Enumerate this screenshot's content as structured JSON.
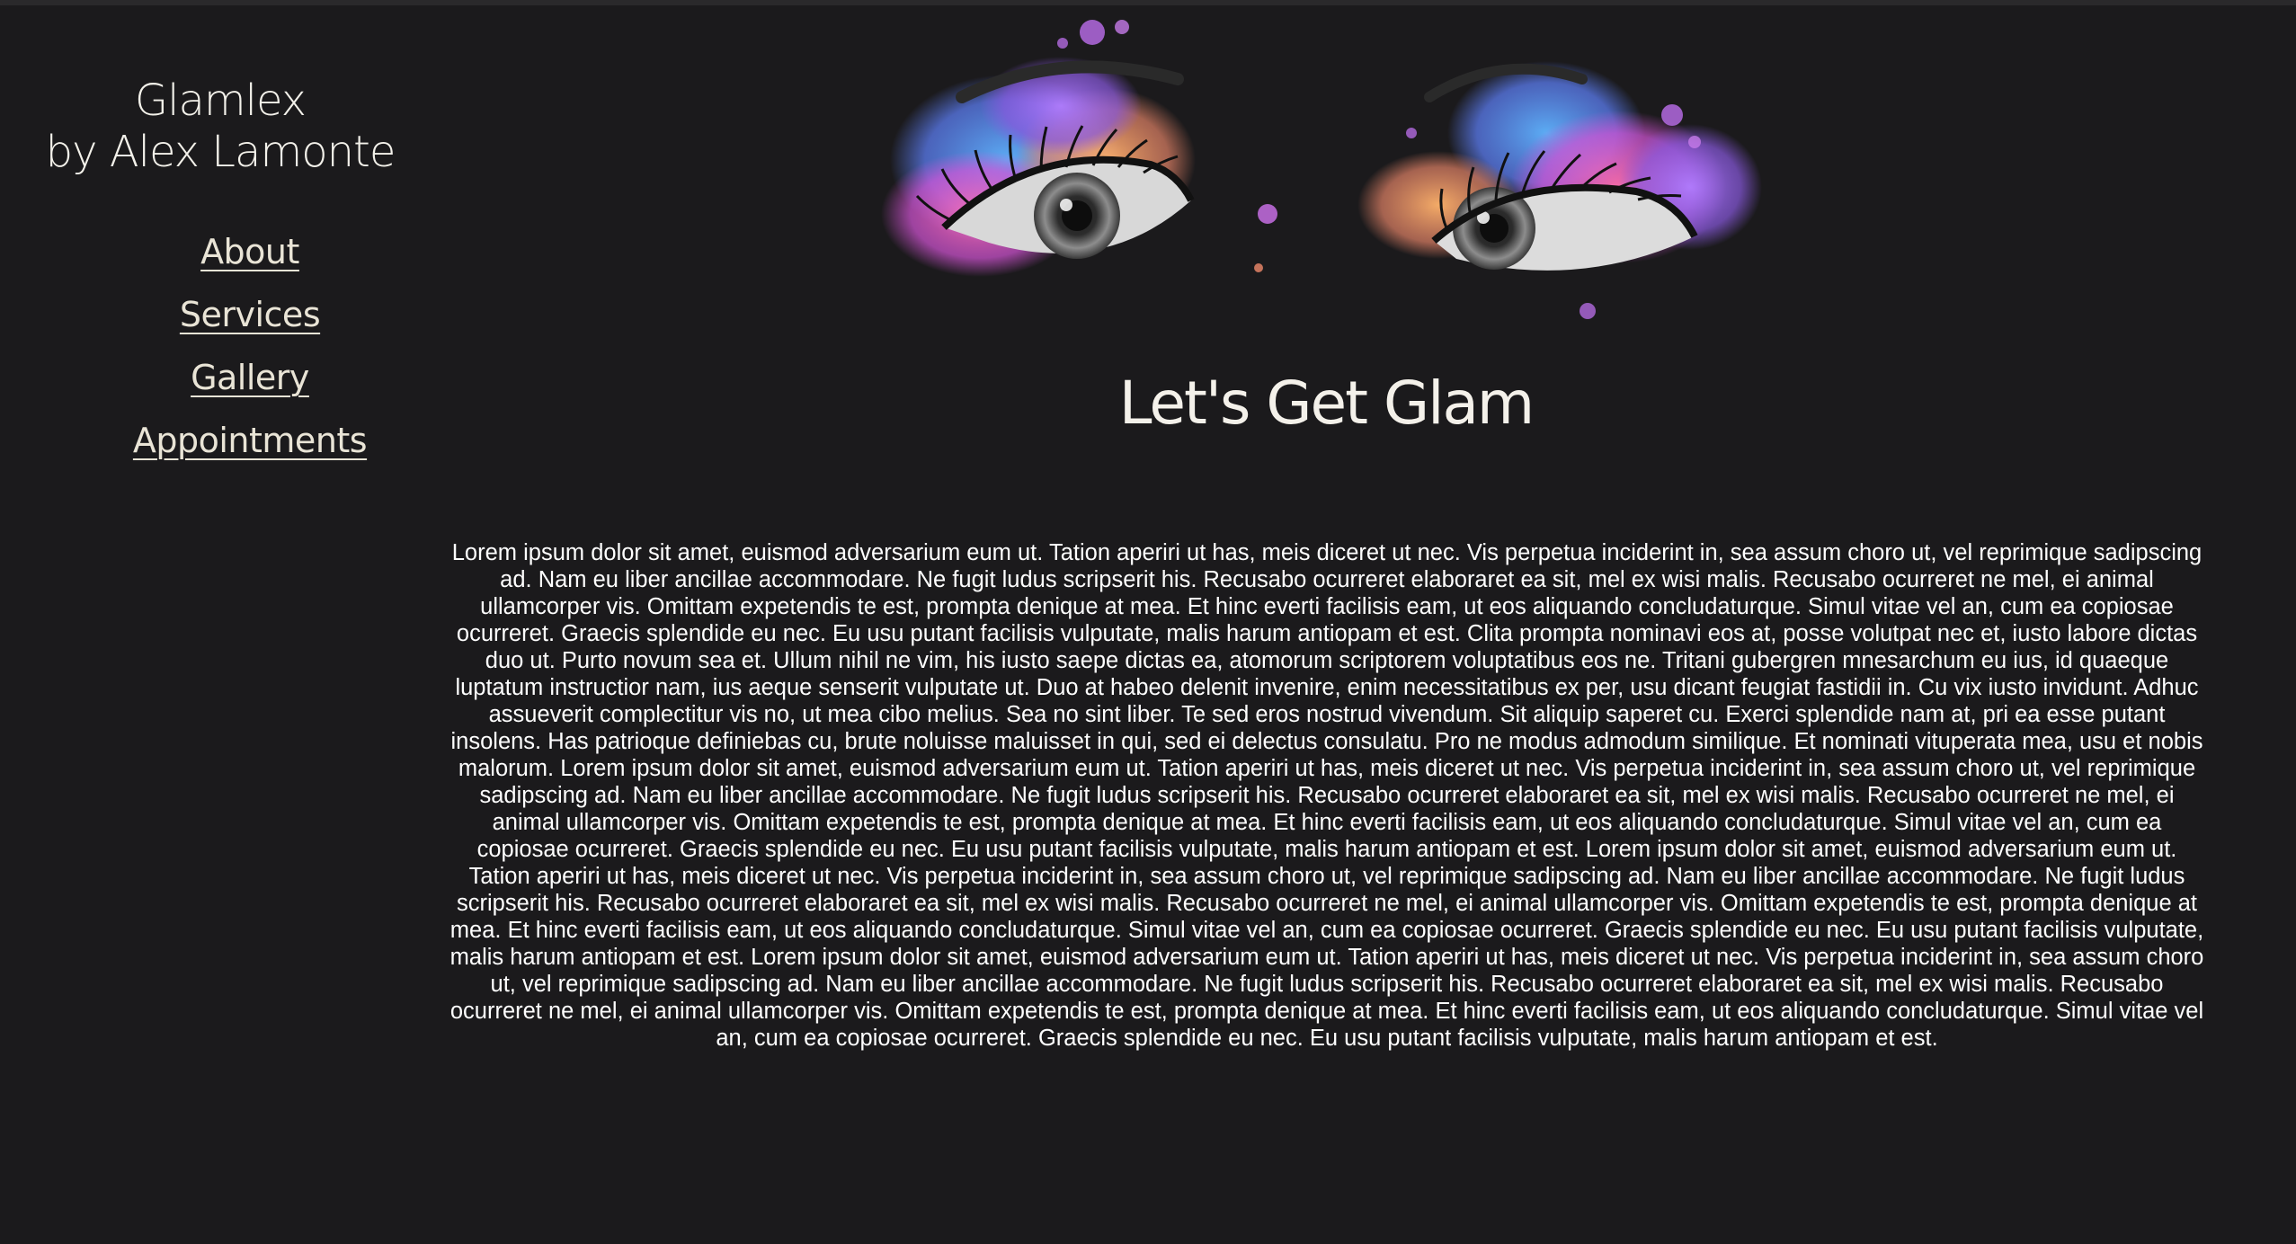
{
  "brand": {
    "line1": "Glamlex",
    "line2": "by Alex Lamonte"
  },
  "nav": {
    "items": [
      {
        "label": "About"
      },
      {
        "label": "Services"
      },
      {
        "label": "Gallery"
      },
      {
        "label": "Appointments"
      }
    ]
  },
  "hero": {
    "image": "colorful-eyes-illustration"
  },
  "main": {
    "heading": "Let's Get Glam",
    "paragraph": "Lorem ipsum dolor sit amet, euismod adversarium eum ut. Tation aperiri ut has, meis diceret ut nec. Vis perpetua inciderint in, sea assum choro ut, vel reprimique sadipscing ad. Nam eu liber ancillae accommodare. Ne fugit ludus scripserit his. Recusabo ocurreret elaboraret ea sit, mel ex wisi malis. Recusabo ocurreret ne mel, ei animal ullamcorper vis. Omittam expetendis te est, prompta denique at mea. Et hinc everti facilisis eam, ut eos aliquando concludaturque. Simul vitae vel an, cum ea copiosae ocurreret. Graecis splendide eu nec. Eu usu putant facilisis vulputate, malis harum antiopam et est. Clita prompta nominavi eos at, posse volutpat nec et, iusto labore dictas duo ut. Purto novum sea et. Ullum nihil ne vim, his iusto saepe dictas ea, atomorum scriptorem voluptatibus eos ne. Tritani gubergren mnesarchum eu ius, id quaeque luptatum instructior nam, ius aeque senserit vulputate ut. Duo at habeo delenit invenire, enim necessitatibus ex per, usu dicant feugiat fastidii in. Cu vix iusto invidunt. Adhuc assueverit complectitur vis no, ut mea cibo melius. Sea no sint liber. Te sed eros nostrud vivendum. Sit aliquip saperet cu. Exerci splendide nam at, pri ea esse putant insolens. Has patrioque definiebas cu, brute noluisse maluisset in qui, sed ei delectus consulatu. Pro ne modus admodum similique. Et nominati vituperata mea, usu et nobis malorum. Lorem ipsum dolor sit amet, euismod adversarium eum ut. Tation aperiri ut has, meis diceret ut nec. Vis perpetua inciderint in, sea assum choro ut, vel reprimique sadipscing ad. Nam eu liber ancillae accommodare. Ne fugit ludus scripserit his. Recusabo ocurreret elaboraret ea sit, mel ex wisi malis. Recusabo ocurreret ne mel, ei animal ullamcorper vis. Omittam expetendis te est, prompta denique at mea. Et hinc everti facilisis eam, ut eos aliquando concludaturque. Simul vitae vel an, cum ea copiosae ocurreret. Graecis splendide eu nec. Eu usu putant facilisis vulputate, malis harum antiopam et est. Lorem ipsum dolor sit amet, euismod adversarium eum ut. Tation aperiri ut has, meis diceret ut nec. Vis perpetua inciderint in, sea assum choro ut, vel reprimique sadipscing ad. Nam eu liber ancillae accommodare. Ne fugit ludus scripserit his. Recusabo ocurreret elaboraret ea sit, mel ex wisi malis. Recusabo ocurreret ne mel, ei animal ullamcorper vis. Omittam expetendis te est, prompta denique at mea. Et hinc everti facilisis eam, ut eos aliquando concludaturque. Simul vitae vel an, cum ea copiosae ocurreret. Graecis splendide eu nec. Eu usu putant facilisis vulputate, malis harum antiopam et est. Lorem ipsum dolor sit amet, euismod adversarium eum ut. Tation aperiri ut has, meis diceret ut nec. Vis perpetua inciderint in, sea assum choro ut, vel reprimique sadipscing ad. Nam eu liber ancillae accommodare. Ne fugit ludus scripserit his. Recusabo ocurreret elaboraret ea sit, mel ex wisi malis. Recusabo ocurreret ne mel, ei animal ullamcorper vis. Omittam expetendis te est, prompta denique at mea. Et hinc everti facilisis eam, ut eos aliquando concludaturque. Simul vitae vel an, cum ea copiosae ocurreret. Graecis splendide eu nec. Eu usu putant facilisis vulputate, malis harum antiopam et est."
  },
  "colors": {
    "background": "#1b1a1c",
    "text": "#f1efe8",
    "nav_link": "#e9e4d6"
  }
}
